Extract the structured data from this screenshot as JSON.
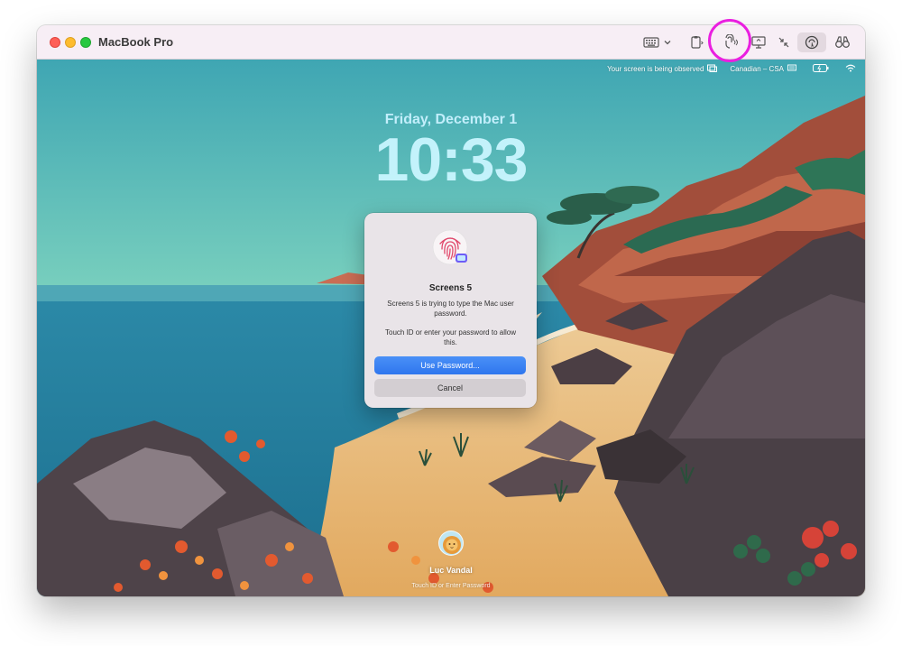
{
  "window": {
    "title": "MacBook Pro"
  },
  "toolbar": {
    "icons": [
      "keyboard-icon",
      "chevron-down-icon",
      "clipboard-icon",
      "touch-id-icon",
      "display-icon",
      "collapse-icon",
      "curtain-icon",
      "binoculars-icon"
    ]
  },
  "status_bar": {
    "observed_text": "Your screen is being observed",
    "keyboard_layout": "Canadian – CSA"
  },
  "lock_screen": {
    "date": "Friday, December 1",
    "time": "10:33"
  },
  "dialog": {
    "title": "Screens 5",
    "message": "Screens 5 is trying to type the Mac user password.",
    "instruction": "Touch ID or enter your password to allow this.",
    "primary_button": "Use Password...",
    "cancel_button": "Cancel"
  },
  "user": {
    "name": "Luc Vandal",
    "hint": "Touch ID or Enter Password"
  },
  "colors": {
    "accent": "#3b82f6",
    "highlight": "#ea1fe0",
    "sky": "#6fc6bd",
    "sand": "#e6b56b"
  }
}
